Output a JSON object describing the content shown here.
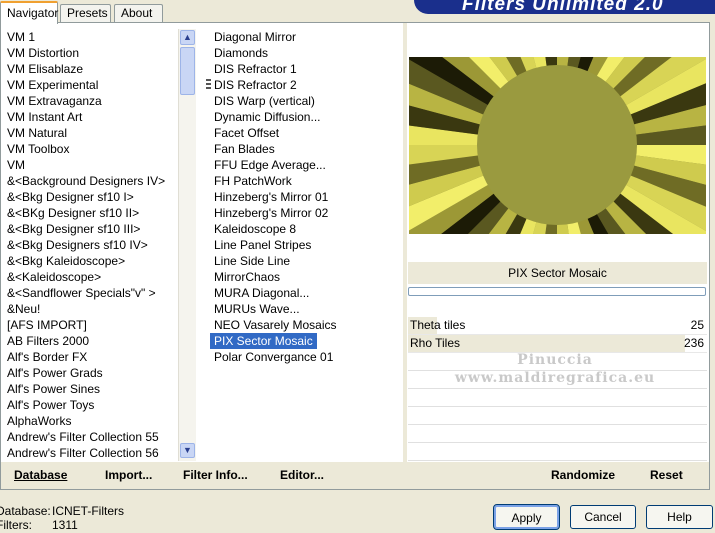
{
  "tabs": [
    "Navigator",
    "Presets",
    "About"
  ],
  "brand": "Filters Unlimited 2.0",
  "categories": [
    "VM 1",
    "VM Distortion",
    "VM Elisablaze",
    "VM Experimental",
    "VM Extravaganza",
    "VM Instant Art",
    "VM Natural",
    "VM Toolbox",
    "VM",
    "&<Background Designers IV>",
    "&<Bkg Designer sf10 I>",
    "&<BKg Designer sf10 II>",
    "&<Bkg Designer sf10 III>",
    "&<Bkg Designers sf10 IV>",
    "&<Bkg Kaleidoscope>",
    "&<Kaleidoscope>",
    "&<Sandflower Specials\"v\" >",
    "&Neu!",
    "[AFS IMPORT]",
    "AB Filters 2000",
    "Alf's Border FX",
    "Alf's Power Grads",
    "Alf's Power Sines",
    "Alf's Power Toys",
    "AlphaWorks",
    "Andrew's Filter Collection 55",
    "Andrew's Filter Collection 56"
  ],
  "selected_category": "&<BKg Designer sf10 II>",
  "filters": [
    "Diagonal Mirror",
    "Diamonds",
    "DIS Refractor 1",
    "DIS Refractor 2",
    "DIS Warp (vertical)",
    "Dynamic Diffusion...",
    "Facet Offset",
    "Fan Blades",
    "FFU Edge Average...",
    "FH PatchWork",
    "Hinzeberg's Mirror 01",
    "Hinzeberg's Mirror 02",
    "Kaleidoscope 8",
    "Line Panel Stripes",
    "Line Side Line",
    "MirrorChaos",
    "MURA Diagonal...",
    "MURUs Wave...",
    "NEO Vasarely Mosaics",
    "PIX Sector Mosaic",
    "Polar Convergance 01"
  ],
  "selected_filter": "PIX Sector Mosaic",
  "bottom_buttons": {
    "database": "Database",
    "import": "Import...",
    "filter_info": "Filter Info...",
    "editor": "Editor...",
    "randomize": "Randomize",
    "reset": "Reset"
  },
  "filter_name": "PIX Sector Mosaic",
  "params": [
    {
      "name": "Theta tiles",
      "value": "25",
      "level": 0.0981
    },
    {
      "name": "Rho Tiles",
      "value": "236",
      "level": 0.9255
    }
  ],
  "watermark": [
    "Pinuccia",
    "www.maldiregrafica.eu"
  ],
  "status": {
    "database_label": "Database:",
    "database_value": "ICNET-Filters",
    "filters_label": "Filters:",
    "filters_value": "1311"
  },
  "dialog": {
    "apply": "Apply",
    "cancel": "Cancel",
    "help": "Help"
  },
  "colors": {
    "selection": "#316ac5",
    "brand_bg": "#1a2f8c",
    "preview_center": "#9a9a3f"
  }
}
